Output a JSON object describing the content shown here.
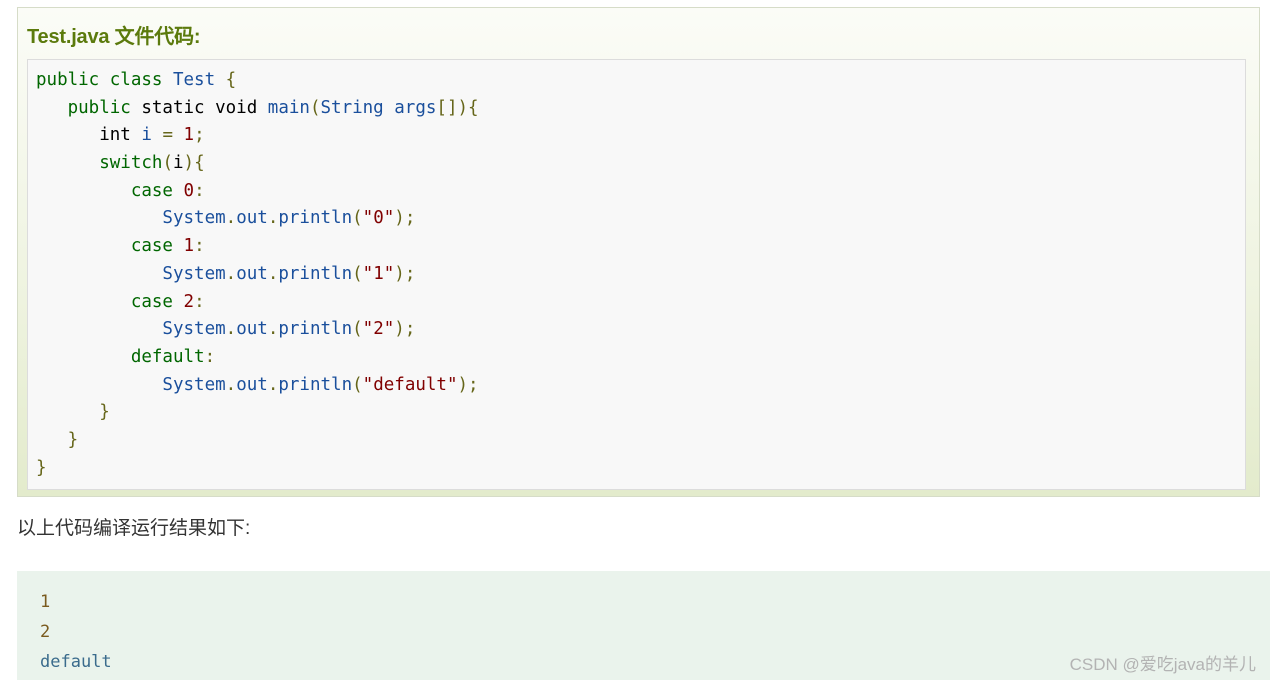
{
  "example": {
    "title": "Test.java 文件代码:",
    "code_lines": [
      [
        {
          "t": "public class ",
          "c": "kw"
        },
        {
          "t": "Test",
          "c": "cls"
        },
        {
          "t": " {",
          "c": "pun"
        }
      ],
      [
        {
          "t": "   public ",
          "c": "kw"
        },
        {
          "t": "static void ",
          "c": "pln"
        },
        {
          "t": "main",
          "c": "cls"
        },
        {
          "t": "(",
          "c": "pun"
        },
        {
          "t": "String args",
          "c": "cls"
        },
        {
          "t": "[]){",
          "c": "pun"
        }
      ],
      [
        {
          "t": "      int ",
          "c": "pln"
        },
        {
          "t": "i",
          "c": "cls"
        },
        {
          "t": " = ",
          "c": "pun"
        },
        {
          "t": "1",
          "c": "num"
        },
        {
          "t": ";",
          "c": "pun"
        }
      ],
      [
        {
          "t": "      switch",
          "c": "kw"
        },
        {
          "t": "(",
          "c": "pun"
        },
        {
          "t": "i",
          "c": "pln"
        },
        {
          "t": "){",
          "c": "pun"
        }
      ],
      [
        {
          "t": "         case ",
          "c": "kw"
        },
        {
          "t": "0",
          "c": "num"
        },
        {
          "t": ":",
          "c": "pun"
        }
      ],
      [
        {
          "t": "            System",
          "c": "cls"
        },
        {
          "t": ".",
          "c": "pun"
        },
        {
          "t": "out",
          "c": "cls"
        },
        {
          "t": ".",
          "c": "pun"
        },
        {
          "t": "println",
          "c": "cls"
        },
        {
          "t": "(",
          "c": "pun"
        },
        {
          "t": "\"0\"",
          "c": "str"
        },
        {
          "t": ");",
          "c": "pun"
        }
      ],
      [
        {
          "t": "         case ",
          "c": "kw"
        },
        {
          "t": "1",
          "c": "num"
        },
        {
          "t": ":",
          "c": "pun"
        }
      ],
      [
        {
          "t": "            System",
          "c": "cls"
        },
        {
          "t": ".",
          "c": "pun"
        },
        {
          "t": "out",
          "c": "cls"
        },
        {
          "t": ".",
          "c": "pun"
        },
        {
          "t": "println",
          "c": "cls"
        },
        {
          "t": "(",
          "c": "pun"
        },
        {
          "t": "\"1\"",
          "c": "str"
        },
        {
          "t": ");",
          "c": "pun"
        }
      ],
      [
        {
          "t": "         case ",
          "c": "kw"
        },
        {
          "t": "2",
          "c": "num"
        },
        {
          "t": ":",
          "c": "pun"
        }
      ],
      [
        {
          "t": "            System",
          "c": "cls"
        },
        {
          "t": ".",
          "c": "pun"
        },
        {
          "t": "out",
          "c": "cls"
        },
        {
          "t": ".",
          "c": "pun"
        },
        {
          "t": "println",
          "c": "cls"
        },
        {
          "t": "(",
          "c": "pun"
        },
        {
          "t": "\"2\"",
          "c": "str"
        },
        {
          "t": ");",
          "c": "pun"
        }
      ],
      [
        {
          "t": "         default",
          "c": "kw"
        },
        {
          "t": ":",
          "c": "pun"
        }
      ],
      [
        {
          "t": "            System",
          "c": "cls"
        },
        {
          "t": ".",
          "c": "pun"
        },
        {
          "t": "out",
          "c": "cls"
        },
        {
          "t": ".",
          "c": "pun"
        },
        {
          "t": "println",
          "c": "cls"
        },
        {
          "t": "(",
          "c": "pun"
        },
        {
          "t": "\"default\"",
          "c": "str"
        },
        {
          "t": ");",
          "c": "pun"
        }
      ],
      [
        {
          "t": "      }",
          "c": "pun"
        }
      ],
      [
        {
          "t": "   }",
          "c": "pun"
        }
      ],
      [
        {
          "t": "}",
          "c": "pun"
        }
      ]
    ]
  },
  "caption": "以上代码编译运行结果如下:",
  "output": {
    "lines": [
      {
        "t": "1",
        "c": "num"
      },
      {
        "t": "2",
        "c": "num"
      },
      {
        "t": "default",
        "c": "word"
      }
    ]
  },
  "watermark": "CSDN @爱吃java的羊儿",
  "colors": {
    "title_green": "#5b7a0c",
    "keyword": "#006600",
    "identifier": "#1a4f9c",
    "punctuation": "#66661a",
    "literal": "#800000",
    "output_bg": "#eaf3ec"
  }
}
